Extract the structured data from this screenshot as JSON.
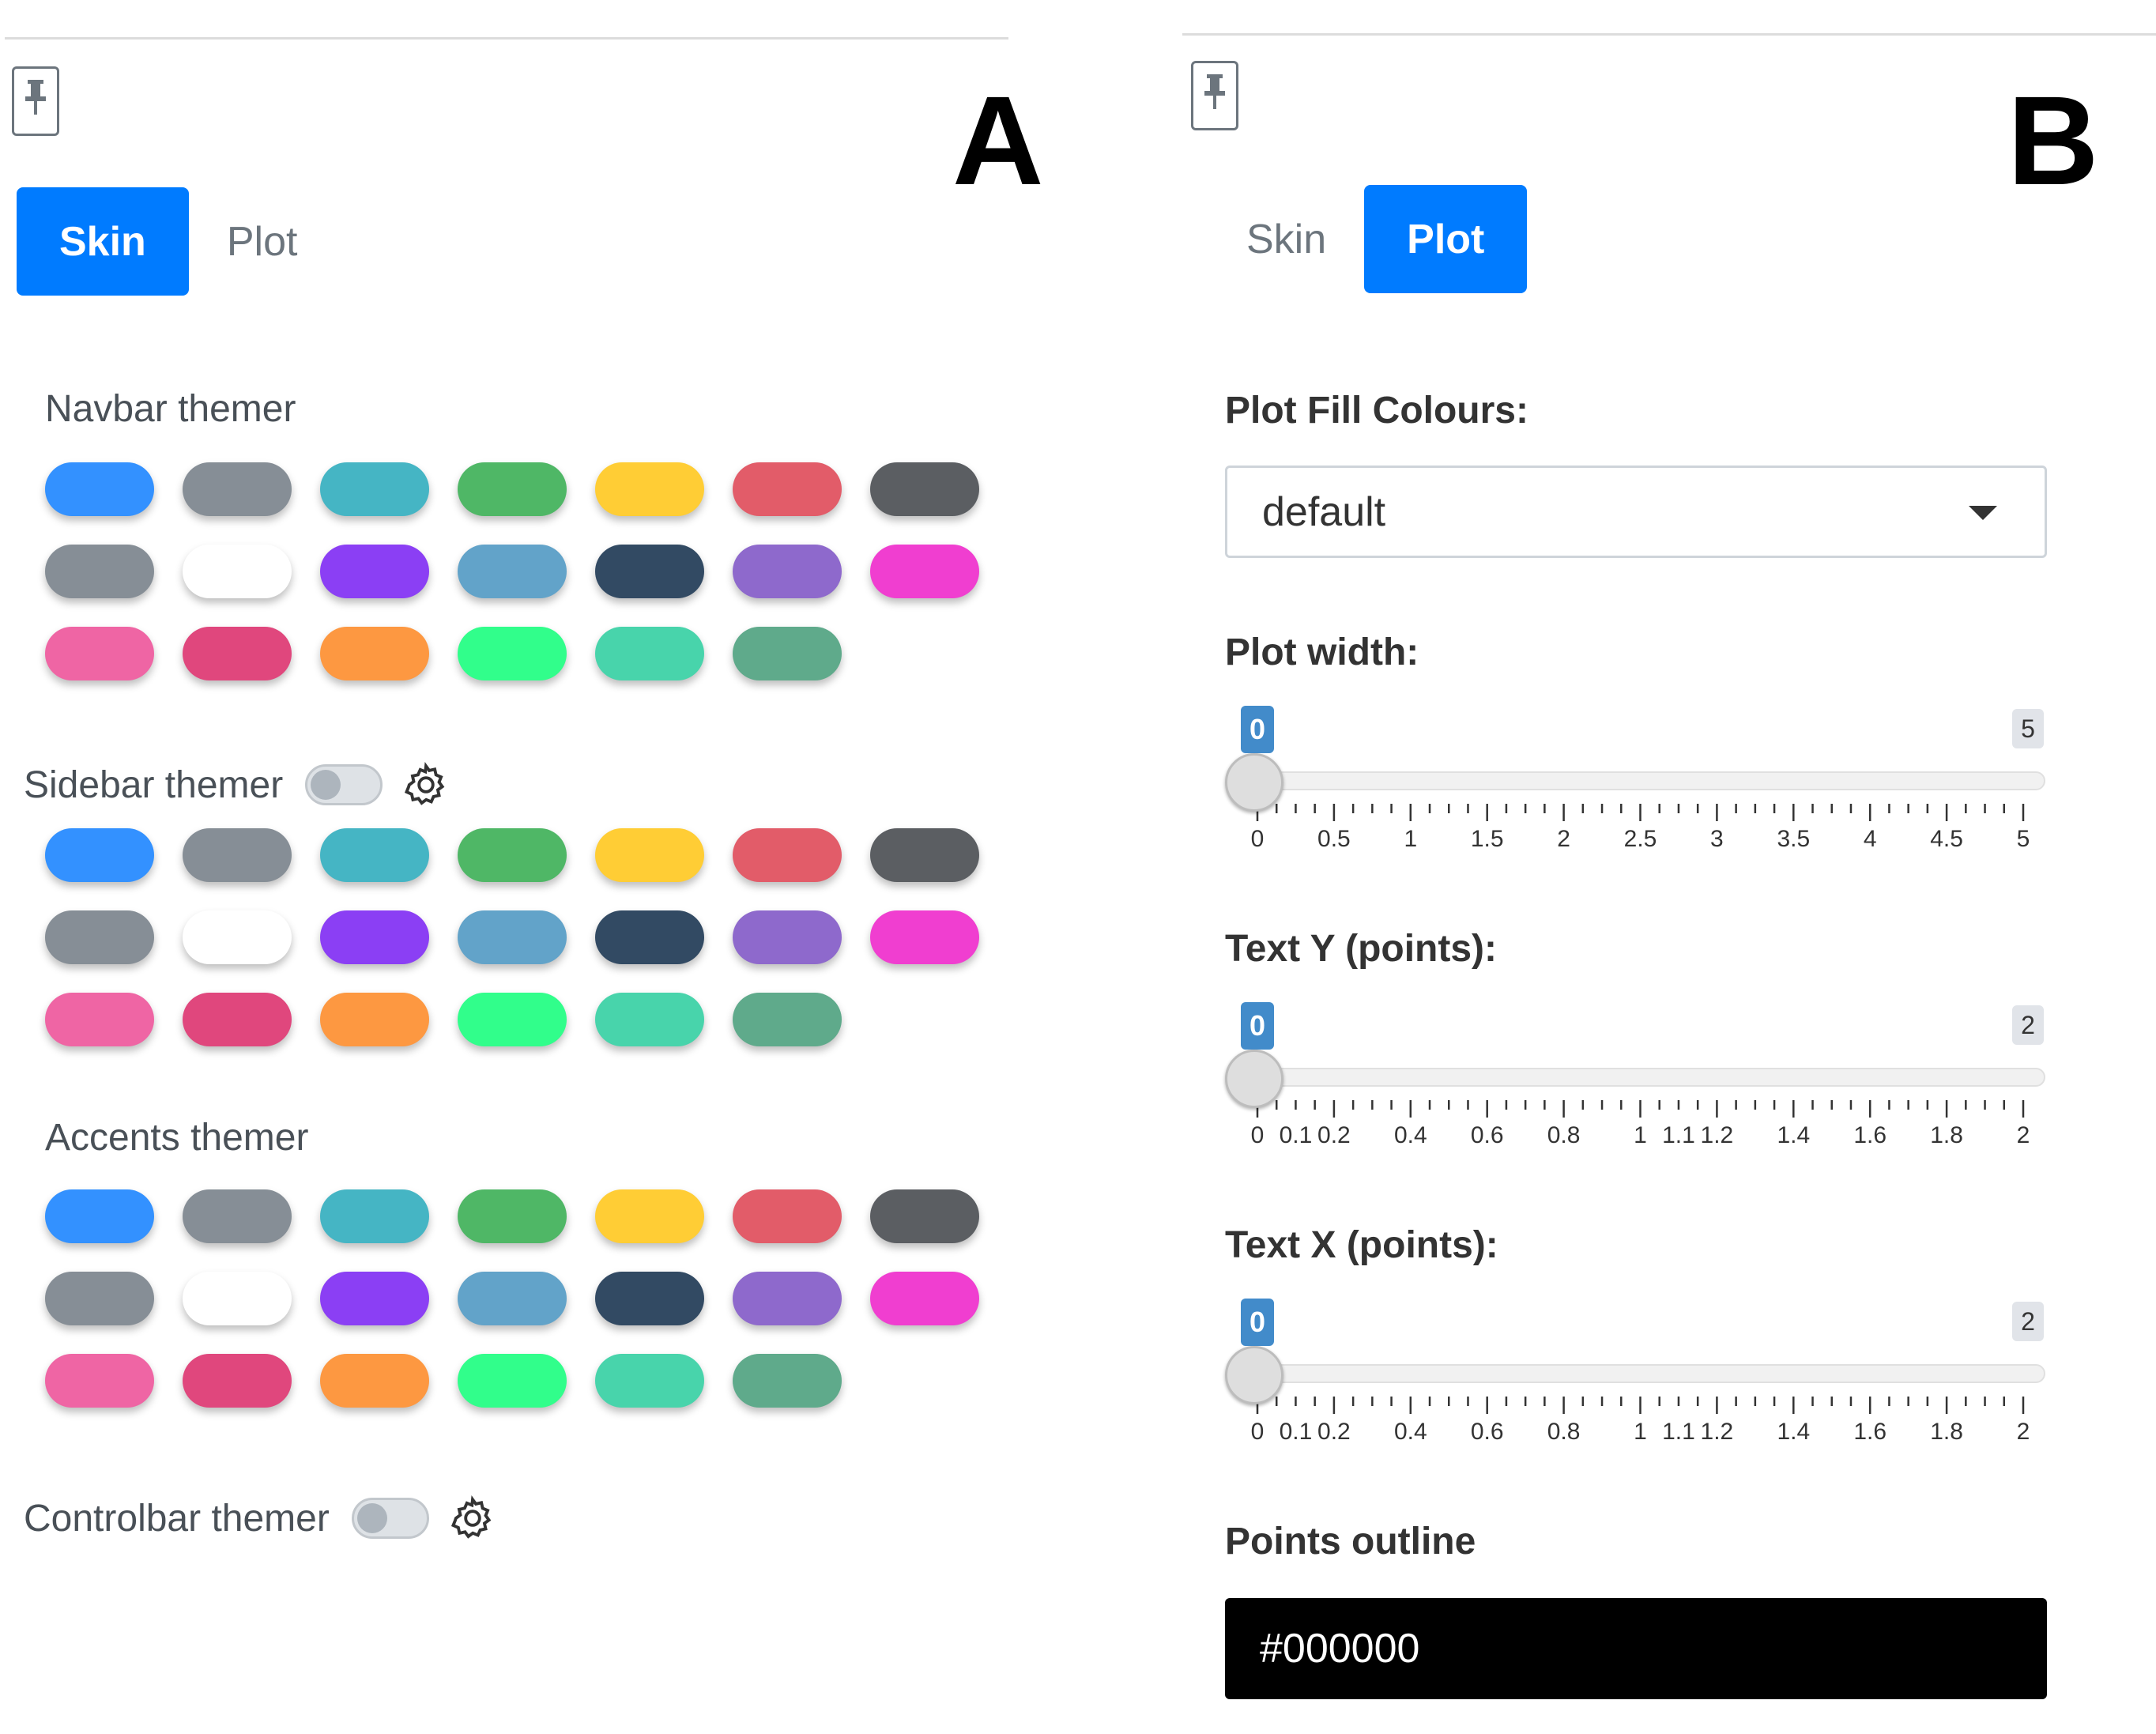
{
  "panel_a": {
    "letter": "A",
    "tabs": [
      {
        "label": "Skin",
        "active": true
      },
      {
        "label": "Plot",
        "active": false
      }
    ],
    "swatch_colors": [
      "#3391ff",
      "#868e96",
      "#45b5c4",
      "#4fb766",
      "#ffcd35",
      "#e25c69",
      "#5b5e62",
      "#868e96",
      "#ffffff",
      "#8b3ff4",
      "#62a3c9",
      "#324a63",
      "#8e69cc",
      "#f03ed0",
      "#ef65a4",
      "#e0477d",
      "#fd9841",
      "#31fe8b",
      "#48d4ab",
      "#5faa8b"
    ],
    "navbar": {
      "label": "Navbar themer"
    },
    "sidebar": {
      "label": "Sidebar themer",
      "toggle_on": false,
      "icon": "gear-icon"
    },
    "accents": {
      "label": "Accents themer"
    },
    "controlbar": {
      "label": "Controlbar themer",
      "toggle_on": false,
      "icon": "gear-icon"
    }
  },
  "panel_b": {
    "letter": "B",
    "tabs": [
      {
        "label": "Skin",
        "active": false
      },
      {
        "label": "Plot",
        "active": true
      }
    ],
    "fill": {
      "label": "Plot Fill Colours:",
      "value": "default"
    },
    "sliders": [
      {
        "label": "Plot width:",
        "min_badge": "0",
        "max_badge": "5",
        "value": 0,
        "min": 0,
        "max": 5,
        "ticks": [
          "0",
          "0.5",
          "1",
          "1.5",
          "2",
          "2.5",
          "3",
          "3.5",
          "4",
          "4.5",
          "5"
        ]
      },
      {
        "label": "Text Y (points):",
        "min_badge": "0",
        "max_badge": "2",
        "value": 0,
        "min": 0,
        "max": 2,
        "ticks": [
          "0",
          "0.1",
          "0.2",
          "0.4",
          "0.6",
          "0.8",
          "1",
          "1.1",
          "1.2",
          "1.4",
          "1.6",
          "1.8",
          "2"
        ]
      },
      {
        "label": "Text X (points):",
        "min_badge": "0",
        "max_badge": "2",
        "value": 0,
        "min": 0,
        "max": 2,
        "ticks": [
          "0",
          "0.1",
          "0.2",
          "0.4",
          "0.6",
          "0.8",
          "1",
          "1.1",
          "1.2",
          "1.4",
          "1.6",
          "1.8",
          "2"
        ]
      }
    ],
    "outline": {
      "label": "Points outline",
      "value": "#000000"
    }
  }
}
